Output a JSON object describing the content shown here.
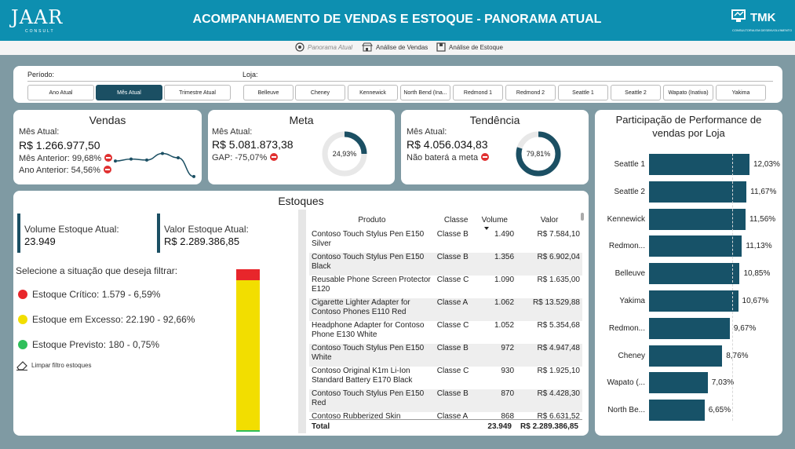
{
  "header": {
    "logo_left": "JAAR",
    "logo_left_sub": "CONSULT",
    "title": "ACOMPANHAMENTO DE VENDAS E ESTOQUE - PANORAMA ATUAL",
    "logo_right": "TMK",
    "logo_right_sub": "CONSULTORIA EM DESENVOLVIMENTO"
  },
  "nav": [
    {
      "label": "Panorama Atual",
      "icon": "target-icon"
    },
    {
      "label": "Análise de Vendas",
      "icon": "store-icon"
    },
    {
      "label": "Análise de Estoque",
      "icon": "box-icon"
    }
  ],
  "filters": {
    "periodo_label": "Período:",
    "periodo": [
      "Ano Atual",
      "Mês Atual",
      "Trimestre Atual"
    ],
    "periodo_selected": "Mês Atual",
    "loja_label": "Loja:",
    "lojas": [
      "Belleuve",
      "Cheney",
      "Kennewick",
      "North Bend (Ina...",
      "Redmond 1",
      "Redmond 2",
      "Seattle 1",
      "Seattle 2",
      "Wapato (Inativa)",
      "Yakima"
    ]
  },
  "vendas": {
    "title": "Vendas",
    "label": "Mês Atual:",
    "value": "R$ 1.266.977,50",
    "mes_anterior": "Mês Anterior: 99,68%",
    "ano_anterior": "Ano Anterior: 54,56%",
    "sparkline": [
      0.52,
      0.58,
      0.55,
      0.75,
      0.62,
      0.05
    ]
  },
  "meta": {
    "title": "Meta",
    "label": "Mês Atual:",
    "value": "R$ 5.081.873,38",
    "gap": "GAP: -75,07%",
    "donut_label": "24,93%",
    "donut_value": 0.2493
  },
  "tendencia": {
    "title": "Tendência",
    "label": "Mês Atual:",
    "value": "R$ 4.056.034,83",
    "note": "Não baterá a meta",
    "donut_label": "79,81%",
    "donut_value": 0.7981
  },
  "estoques": {
    "title": "Estoques",
    "volume_label": "Volume Estoque Atual:",
    "volume_value": "23.949",
    "valor_label": "Valor Estoque Atual:",
    "valor_value": "R$ 2.289.386,85",
    "filter_prompt": "Selecione a situação que deseja filtrar:",
    "critico": "Estoque Crítico: 1.579 - 6,59%",
    "excesso": "Estoque em Excesso: 22.190 - 92,66%",
    "previsto": "Estoque Previsto: 180 - 0,75%",
    "limpar": "Limpar filtro estoques",
    "colors": {
      "critico": "#e8262b",
      "excesso": "#f2de00",
      "previsto": "#2fbf5a"
    },
    "stack": {
      "critico": 0.0659,
      "excesso": 0.9266,
      "previsto": 0.0075
    }
  },
  "table": {
    "headers": [
      "Produto",
      "Classe",
      "Volume",
      "Valor"
    ],
    "rows": [
      [
        "Contoso Touch Stylus Pen E150 Silver",
        "Classe B",
        "1.490",
        "R$ 7.584,10"
      ],
      [
        "Contoso Touch Stylus Pen E150 Black",
        "Classe B",
        "1.356",
        "R$ 6.902,04"
      ],
      [
        "Reusable Phone Screen Protector E120",
        "Classe C",
        "1.090",
        "R$ 1.635,00"
      ],
      [
        "Cigarette Lighter Adapter for Contoso Phones E110 Red",
        "Classe A",
        "1.062",
        "R$ 13.529,88"
      ],
      [
        "Headphone Adapter for Contoso Phone E130 White",
        "Classe C",
        "1.052",
        "R$ 5.354,68"
      ],
      [
        "Contoso Touch Stylus Pen E150 White",
        "Classe B",
        "972",
        "R$ 4.947,48"
      ],
      [
        "Contoso Original K1m Li-Ion Standard Battery E170 Black",
        "Classe C",
        "930",
        "R$ 1.925,10"
      ],
      [
        "Contoso Touch Stylus Pen E150 Red",
        "Classe B",
        "870",
        "R$ 4.428,30"
      ],
      [
        "Contoso Rubberized Skin",
        "Classe A",
        "868",
        "R$ 6.631,52"
      ]
    ],
    "total_label": "Total",
    "total_volume": "23.949",
    "total_valor": "R$ 2.289.386,85"
  },
  "chart_data": {
    "type": "bar",
    "title": "Participação de Performance de vendas por Loja",
    "categories": [
      "Seattle 1",
      "Seattle 2",
      "Kennewick",
      "Redmon...",
      "Belleuve",
      "Yakima",
      "Redmon...",
      "Cheney",
      "Wapato (...",
      "North Be..."
    ],
    "values": [
      12.03,
      11.67,
      11.56,
      11.13,
      10.85,
      10.67,
      9.67,
      8.76,
      7.03,
      6.65
    ],
    "labels": [
      "12,03%",
      "11,67%",
      "11,56%",
      "11,13%",
      "10,85%",
      "10,67%",
      "9,67%",
      "8,76%",
      "7,03%",
      "6,65%"
    ],
    "reference_line": 10.0,
    "xlim": [
      0,
      12.03
    ],
    "color": "#175268"
  }
}
